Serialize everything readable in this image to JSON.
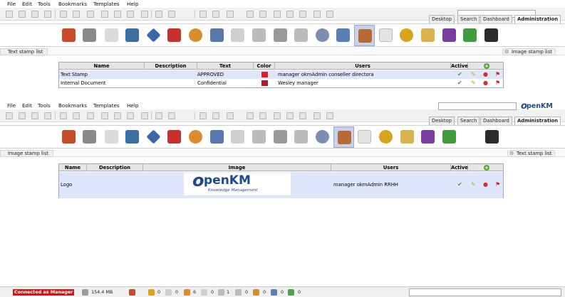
{
  "menu": [
    "File",
    "Edit",
    "Tools",
    "Bookmarks",
    "Templates",
    "Help"
  ],
  "tabs": [
    "Desktop",
    "Search",
    "Dashboard",
    "Administration"
  ],
  "brand": {
    "logo_text": "penKM",
    "logo_letter": "o",
    "color": "#1b4b8c"
  },
  "toolbar_icons": [
    "folder-icon",
    "document-icon",
    "lock-icon",
    "unlock-icon",
    "upload-icon",
    "download-icon",
    "delete-icon",
    "copy-icon",
    "move-icon",
    "rename-icon",
    "subscribe-icon",
    "bookmark-icon",
    "home-icon",
    "refresh-icon",
    "zoom-icon",
    "stamp-icon"
  ],
  "admin_icons": [
    {
      "name": "home-icon",
      "color": "#c94a2b"
    },
    {
      "name": "tools-icon",
      "color": "#7a7a7a"
    },
    {
      "name": "search-doc-icon",
      "color": "#d9d9d9"
    },
    {
      "name": "monitor-icon",
      "color": "#3a6ea5"
    },
    {
      "name": "diamond-icon",
      "color": "#3c66a8"
    },
    {
      "name": "scissors-icon",
      "color": "#c8302c"
    },
    {
      "name": "users-icon",
      "color": "#d98c2b"
    },
    {
      "name": "profiles-icon",
      "color": "#5577aa"
    },
    {
      "name": "report-icon",
      "color": "#cfcfcf"
    },
    {
      "name": "find-icon",
      "color": "#bcbcbc"
    },
    {
      "name": "scanner-icon",
      "color": "#9a9a9a"
    },
    {
      "name": "calendar-icon",
      "color": "#bbbbbb"
    },
    {
      "name": "gear-icon",
      "color": "#7c8fb0"
    },
    {
      "name": "metadata-icon",
      "color": "#5a7fb8"
    },
    {
      "name": "stamp-icon",
      "color": "#b86a36"
    },
    {
      "name": "log-icon",
      "color": "#e4e4e4"
    },
    {
      "name": "clock-icon",
      "color": "#d9a31b"
    },
    {
      "name": "language-icon",
      "color": "#d8b24a"
    },
    {
      "name": "workflow-icon",
      "color": "#7a3ea3"
    },
    {
      "name": "import-icon",
      "color": "#3f9b3b"
    },
    {
      "name": "terminal-icon",
      "color": "#2b2b2b"
    }
  ],
  "text_stamp_panel": {
    "title": "Text stamp list",
    "switch_label": "Image stamp list",
    "columns": [
      "Name",
      "Description",
      "Text",
      "Color",
      "Users",
      "Active"
    ],
    "rows": [
      {
        "name": "Text Stamp",
        "description": "",
        "text": "APPROVED",
        "color": "#e41e1e",
        "users": "manager okmAdmin conseller directora"
      },
      {
        "name": "Internal Document",
        "description": "",
        "text": "Confidential",
        "color": "#b31d2b",
        "users": "Wesley manager"
      }
    ]
  },
  "image_stamp_panel": {
    "title": "Image stamp list",
    "switch_label": "Text stamp list",
    "columns": [
      "Name",
      "Description",
      "Image",
      "Users",
      "Active"
    ],
    "rows": [
      {
        "name": "Logo",
        "description": "",
        "image_text": "penKM",
        "image_letter": "o",
        "image_subtitle": "Knowledge Management",
        "users": "manager okmAdmin RRHH"
      }
    ]
  },
  "status": {
    "user": "Connected as Manager",
    "disk": "154.4 MB",
    "counts": [
      "0",
      "0",
      "6",
      "0",
      "1",
      "0",
      "0",
      "0",
      "0"
    ]
  }
}
